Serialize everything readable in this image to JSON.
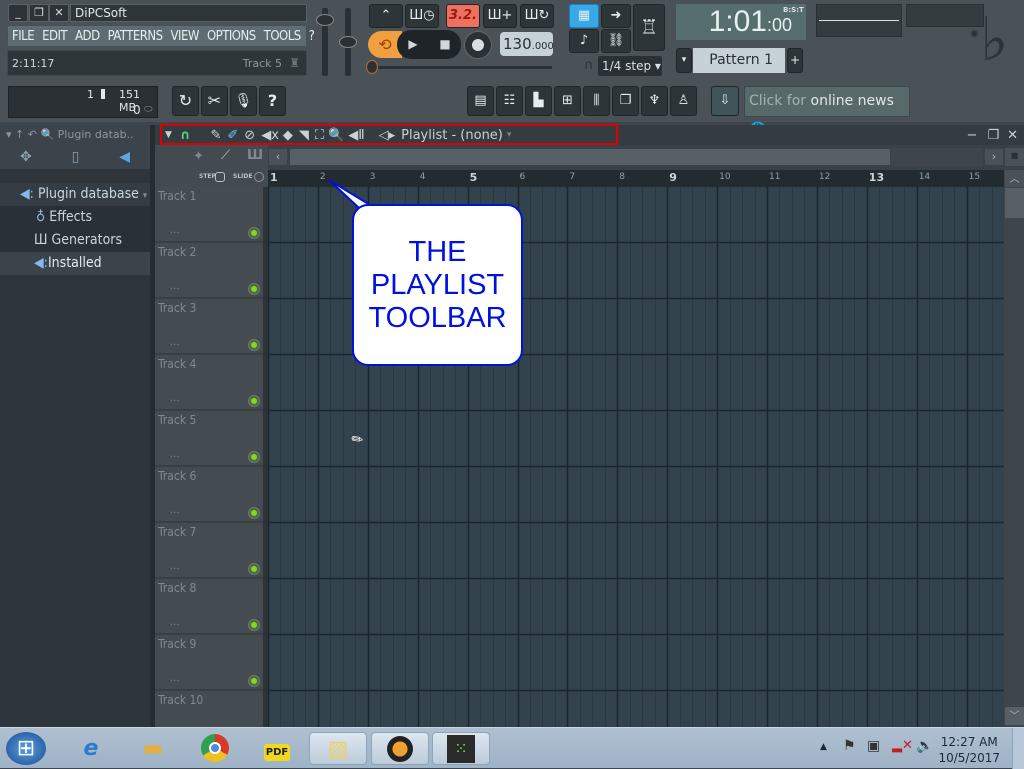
{
  "window": {
    "title": "DiPCSoft",
    "buttons": {
      "minimize": "_",
      "restore": "❐",
      "close": "✕"
    }
  },
  "menu": [
    "FILE",
    "EDIT",
    "ADD",
    "PATTERNS",
    "VIEW",
    "OPTIONS",
    "TOOLS",
    "?"
  ],
  "hint_bar": {
    "time": "2:11:17",
    "target": "Track 5"
  },
  "transport": {
    "tempo": "130",
    "tempo_decimal": ".000",
    "counter_display": "3.2.",
    "snap": "1/4 step",
    "clock_main": "1:01",
    "clock_sub": ":00",
    "clock_label": "B:S:T",
    "pattern": "Pattern 1",
    "pattern_add": "+"
  },
  "monitor": {
    "cpu_value": "1",
    "memory": "151 MB",
    "polyphony": "0"
  },
  "news": {
    "prefix": "Click for",
    "text": "online news"
  },
  "browser": {
    "header": "Plugin datab..",
    "root": "Plugin database",
    "items": [
      {
        "label": "Effects",
        "icon": "effects-icon"
      },
      {
        "label": "Generators",
        "icon": "piano-icon"
      },
      {
        "label": "Installed",
        "icon": "plugin-speaker-icon",
        "selected": true
      }
    ]
  },
  "playlist": {
    "title": "Playlist - (none)",
    "step_label": "STEP",
    "slide_label": "SLIDE",
    "toolbar_icons": [
      "magnet-icon",
      "pencil-icon",
      "paint-icon",
      "delete-icon",
      "mute-icon",
      "slip-icon",
      "slice-icon",
      "select-icon",
      "zoom-icon",
      "playback-icon"
    ],
    "ruler": [
      "1",
      "2",
      "3",
      "4",
      "5",
      "6",
      "7",
      "8",
      "9",
      "10",
      "11",
      "12",
      "13",
      "14",
      "15"
    ],
    "tracks": [
      "Track 1",
      "Track 2",
      "Track 3",
      "Track 4",
      "Track 5",
      "Track 6",
      "Track 7",
      "Track 8",
      "Track 9",
      "Track 10"
    ],
    "track_more": "..."
  },
  "callout": {
    "lines": [
      "THE",
      "PLAYLIST",
      "TOOLBAR"
    ]
  },
  "taskbar": {
    "apps": [
      "start-orb",
      "internet-explorer",
      "file-explorer",
      "chrome",
      "pdf-reader",
      "sticky-notes",
      "fl-studio",
      "camstudio"
    ],
    "time": "12:27 AM",
    "date": "10/5/2017"
  },
  "colors": {
    "highlight_box": "#e00000",
    "callout_text": "#0010e0",
    "led": "#88d22a",
    "tempo_bg": "#c7d2d6"
  }
}
